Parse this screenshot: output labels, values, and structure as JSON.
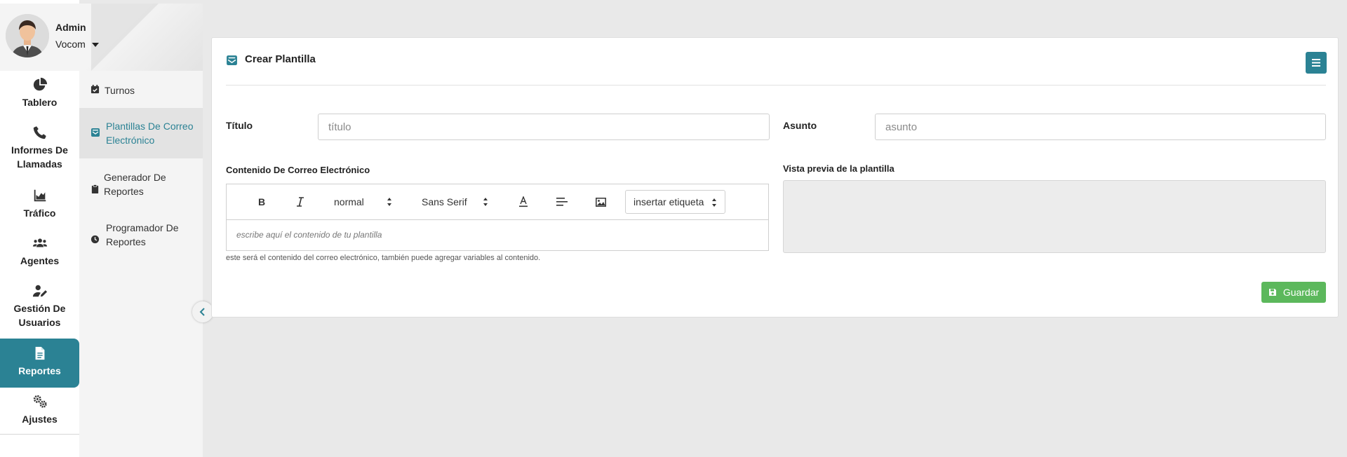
{
  "profile": {
    "name": "Admin",
    "org": "Vocom"
  },
  "rail": [
    {
      "label": "Tablero",
      "icon": "pie-chart-icon"
    },
    {
      "label": "Informes De Llamadas",
      "icon": "phone-icon"
    },
    {
      "label": "Tráfico",
      "icon": "area-chart-icon"
    },
    {
      "label": "Agentes",
      "icon": "users-icon"
    },
    {
      "label": "Gestión De Usuarios",
      "icon": "user-edit-icon"
    },
    {
      "label": "Reportes",
      "icon": "file-icon",
      "active": true
    },
    {
      "label": "Ajustes",
      "icon": "gears-icon"
    }
  ],
  "submenu": [
    {
      "label": "Turnos",
      "icon": "calendar-check-icon"
    },
    {
      "label": "Plantillas De Correo Electrónico",
      "icon": "envelope-open-icon",
      "active": true
    },
    {
      "label": "Generador De Reportes",
      "icon": "clipboard-icon"
    },
    {
      "label": "Programador De Reportes",
      "icon": "clock-icon"
    }
  ],
  "card": {
    "title": "Crear Plantilla",
    "titulo_label": "Título",
    "titulo_placeholder": "título",
    "asunto_label": "Asunto",
    "asunto_placeholder": "asunto",
    "content_label": "Contenido De Correo Electrónico",
    "preview_label": "Vista previa de la plantilla",
    "toolbar": {
      "size": "normal",
      "font": "Sans Serif",
      "tag": "insertar etiqueta"
    },
    "editor_placeholder": "escribe aquí el contenido de tu plantilla",
    "help_text": "este será el contenido del correo electrónico, también puede agregar variables al contenido.",
    "save_label": "Guardar"
  },
  "colors": {
    "accent": "#2b8294",
    "success": "#5cb85c",
    "background": "#e9e9e9"
  }
}
